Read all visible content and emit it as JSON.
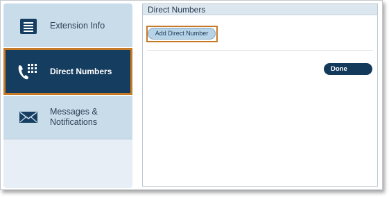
{
  "sidebar": {
    "items": [
      {
        "label": "Extension Info",
        "icon": "document-list-icon"
      },
      {
        "label": "Direct Numbers",
        "icon": "phone-keypad-icon"
      },
      {
        "label": "Messages &\nNotifications",
        "icon": "envelope-icon"
      }
    ]
  },
  "main": {
    "title": "Direct Numbers",
    "add_button_label": "Add Direct Number",
    "done_button_label": "Done"
  },
  "colors": {
    "selected_bg": "#153d5f",
    "highlight": "#c77a25",
    "sidebar_item_bg": "#c9dcea",
    "done_bg": "#143a5b"
  }
}
